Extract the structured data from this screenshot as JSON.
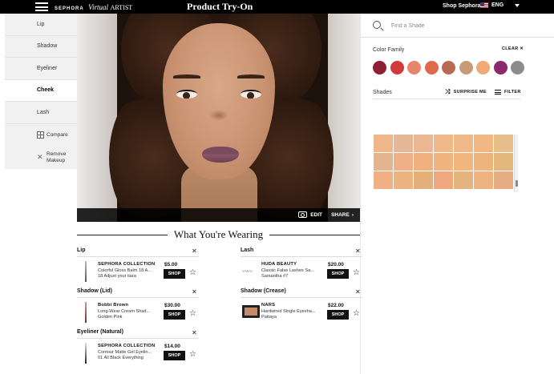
{
  "header": {
    "brand_main": "SEPHORA",
    "brand_virtual": "Virtual",
    "brand_artist": "ARTIST",
    "title": "Product Try-On",
    "shop_link": "Shop Sephora",
    "language": "ENG"
  },
  "sidebar": {
    "items": [
      {
        "label": "Lip"
      },
      {
        "label": "Shadow"
      },
      {
        "label": "Eyeliner"
      },
      {
        "label": "Cheek"
      },
      {
        "label": "Lash"
      }
    ],
    "active": "Cheek",
    "compare_label": "Compare",
    "remove_label_1": "Remove",
    "remove_label_2": "Makeup"
  },
  "photo_bar": {
    "edit_label": "EDIT",
    "share_label": "SHARE"
  },
  "panel": {
    "search_placeholder": "Find a Shade",
    "color_family_label": "Color Family",
    "clear_label": "CLEAR",
    "color_family_swatches": [
      "#8e1f35",
      "#d33a3a",
      "#e8836c",
      "#dd6a4c",
      "#b86b53",
      "#c69b78",
      "#f0a979",
      "#8a2a6a",
      "#8c8c8c"
    ],
    "shades_label": "Shades",
    "surprise_label": "SURPRISE ME",
    "filter_label": "FILTER",
    "shade_grid": [
      "#efb688",
      "#e6b796",
      "#eab993",
      "#f1b889",
      "#f1b987",
      "#f2b884",
      "#e7bf8b",
      "#e2b48f",
      "#efb087",
      "#f1b07f",
      "#f1b37f",
      "#f0b67d",
      "#efb37d",
      "#e3b67b",
      "#f0b083",
      "#ebb37f",
      "#e4b07a",
      "#f0a97f",
      "#e4b47f",
      "#eeb381",
      "#e6ad82"
    ]
  },
  "wearing": {
    "title": "What You're Wearing",
    "sections": [
      {
        "category": "Lip",
        "brand": "SEPHORA COLLECTION",
        "product": "Colorful Gloss Balm 18 A...",
        "shade": "18 Adjust your tiara",
        "price": "$5.00",
        "shop": "SHOP"
      },
      {
        "category": "Lash",
        "brand": "HUDA BEAUTY",
        "product": "Classic False Lashes Sa...",
        "shade": "Samantha #7",
        "price": "$20.00",
        "shop": "SHOP"
      },
      {
        "category": "Shadow (Lid)",
        "brand": "Bobbi Brown",
        "product": "Long-Wear Cream Shad...",
        "shade": "Golden Pink",
        "price": "$30.00",
        "shop": "SHOP"
      },
      {
        "category": "Shadow (Crease)",
        "brand": "NARS",
        "product": "Hardwired Single Eyesha...",
        "shade": "Pattaya",
        "price": "$22.00",
        "shop": "SHOP"
      },
      {
        "category": "Eyeliner (Natural)",
        "brand": "SEPHORA COLLECTION",
        "product": "Contour Matte Gel Eyelin...",
        "shade": "01 All Black Everything",
        "price": "$14.00",
        "shop": "SHOP"
      }
    ]
  }
}
